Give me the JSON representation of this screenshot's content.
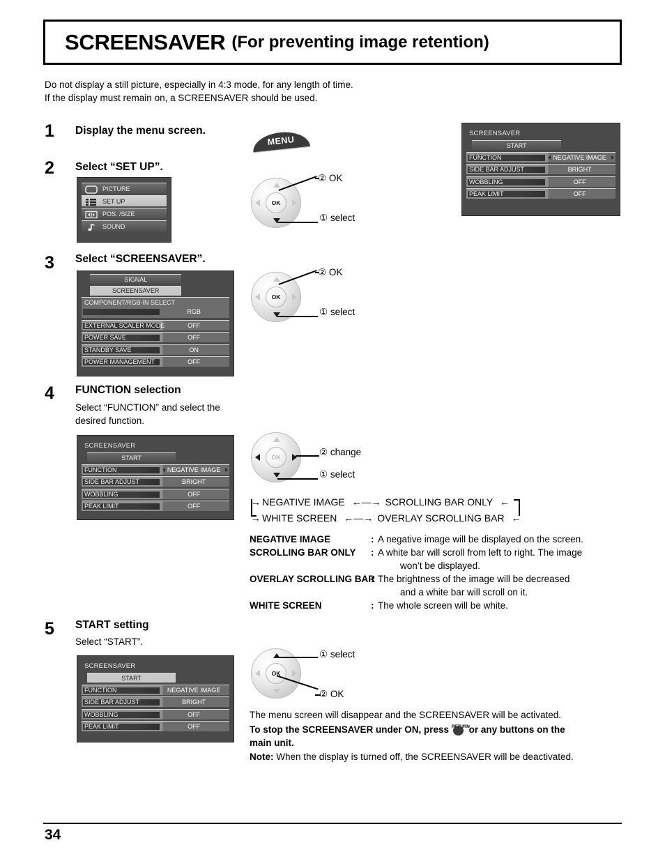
{
  "page": {
    "title_main": "SCREENSAVER",
    "title_sub": "(For preventing image retention)",
    "intro_line1": "Do not display a still picture, especially in 4:3 mode, for any length of time.",
    "intro_line2": "If the display must remain on, a SCREENSAVER should be used.",
    "page_number": "34"
  },
  "steps": {
    "s1": {
      "num": "1",
      "title": "Display the menu screen."
    },
    "s2": {
      "num": "2",
      "title": "Select “SET UP”."
    },
    "s3": {
      "num": "3",
      "title": "Select “SCREENSAVER”."
    },
    "s4": {
      "num": "4",
      "title": "FUNCTION selection",
      "body_line1": "Select “FUNCTION” and select the",
      "body_line2": "desired function."
    },
    "s5": {
      "num": "5",
      "title": "START setting",
      "body_line1": "Select “START”."
    }
  },
  "remote": {
    "menu_label": "MENU",
    "ok_label": "OK",
    "callout_ok": "② OK",
    "callout_select": "① select",
    "callout_change": "② change",
    "callout_select_first": "① select",
    "callout_ok_second": "② OK"
  },
  "main_menu": {
    "items": [
      {
        "label": "PICTURE",
        "icon": "picture-icon",
        "selected": false
      },
      {
        "label": "SET UP",
        "icon": "setup-icon",
        "selected": true
      },
      {
        "label": "POS. /SIZE",
        "icon": "possize-icon",
        "selected": false
      },
      {
        "label": "SOUND",
        "icon": "sound-icon",
        "selected": false
      }
    ]
  },
  "setup_menu": {
    "item_signal": "SIGNAL",
    "item_screensaver": "SCREENSAVER",
    "row_component_label": "COMPONENT/RGB-IN SELECT",
    "row_component_value": "RGB",
    "rows": [
      {
        "label": "EXTERNAL SCALER MODE",
        "value": "OFF"
      },
      {
        "label": "POWER SAVE",
        "value": "OFF"
      },
      {
        "label": "STANDBY SAVE",
        "value": "ON"
      },
      {
        "label": "POWER MANAGEMENT",
        "value": "OFF"
      }
    ]
  },
  "screensaver_menu": {
    "title": "SCREENSAVER",
    "start_label": "START",
    "rows": [
      {
        "label": "FUNCTION",
        "value": "NEGATIVE IMAGE"
      },
      {
        "label": "SIDE BAR ADJUST",
        "value": "BRIGHT"
      },
      {
        "label": "WOBBLING",
        "value": "OFF"
      },
      {
        "label": "PEAK LIMIT",
        "value": "OFF"
      }
    ]
  },
  "cycle": {
    "top_left": "NEGATIVE IMAGE",
    "top_right": "SCROLLING BAR ONLY",
    "bottom_left": "WHITE SCREEN",
    "bottom_right": "OVERLAY SCROLLING BAR"
  },
  "definitions": [
    {
      "term": "NEGATIVE IMAGE",
      "colon": ":",
      "desc_line1": "A negative image will be displayed on the screen.",
      "desc_line2": ""
    },
    {
      "term": "SCROLLING BAR ONLY",
      "colon": ":",
      "desc_line1": "A white bar will scroll from left to right. The image",
      "desc_line2": "won’t be displayed."
    },
    {
      "term": "OVERLAY SCROLLING BAR",
      "colon": ":",
      "desc_line1": "The brightness of the image will be decreased",
      "desc_line2": "and a white bar will scroll on it."
    },
    {
      "term": "WHITE SCREEN",
      "colon": ":",
      "desc_line1": "The whole screen will be white.",
      "desc_line2": ""
    }
  ],
  "closing": {
    "line1": "The menu screen will disappear and the SCREENSAVER will be activated.",
    "bold_a": "To stop the SCREENSAVER under ON, press",
    "return_caption": "RETURN",
    "bold_b": "or any buttons on the",
    "bold_c": "main unit.",
    "note_label": "Note:",
    "note_text": "When the display is turned off, the SCREENSAVER will be deactivated."
  }
}
